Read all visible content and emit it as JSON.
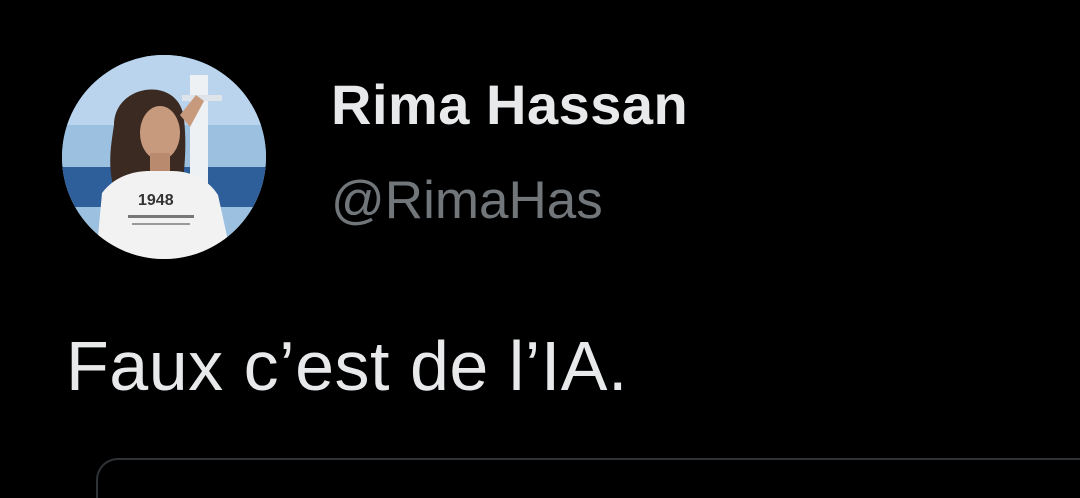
{
  "tweet": {
    "author": {
      "display_name": "Rima Hassan",
      "handle": "@RimaHas",
      "avatar_shirt_text": "1948"
    },
    "text": "Faux c’est de l’IA."
  },
  "colors": {
    "background": "#000000",
    "primary_text": "#e7e9ea",
    "secondary_text": "#71767b",
    "border": "#2f3336"
  }
}
